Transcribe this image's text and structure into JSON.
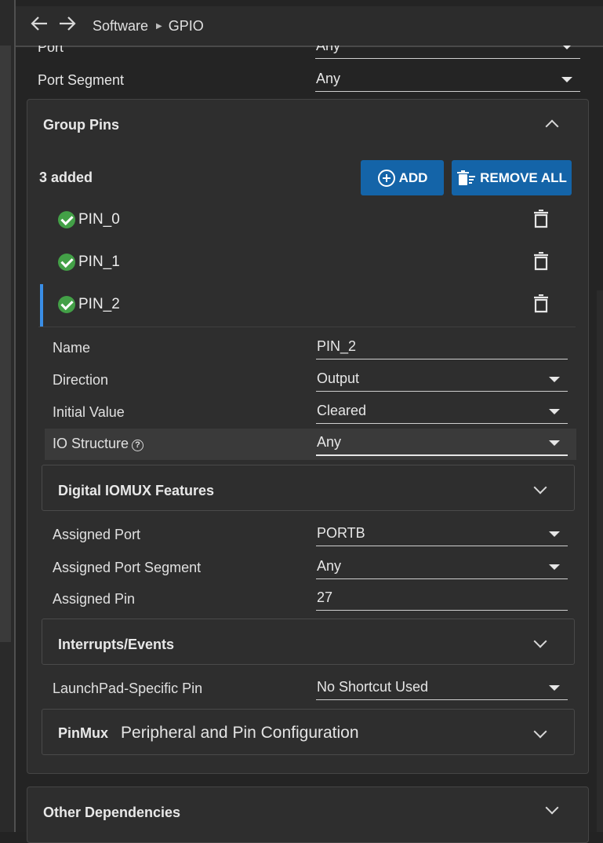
{
  "nav": {
    "back_icon": "arrow-left-icon",
    "forward_icon": "arrow-right-icon",
    "breadcrumb": [
      "Software",
      "GPIO"
    ]
  },
  "top_fields": [
    {
      "label": "Port",
      "value": "Any"
    },
    {
      "label": "Port Segment",
      "value": "Any"
    }
  ],
  "group_pins": {
    "title": "Group Pins",
    "added_count": "3 added",
    "add_label": "ADD",
    "remove_all_label": "REMOVE ALL",
    "pins": [
      {
        "name": "PIN_0",
        "status": "valid"
      },
      {
        "name": "PIN_1",
        "status": "valid"
      },
      {
        "name": "PIN_2",
        "status": "valid",
        "selected": true
      }
    ]
  },
  "pin_config": {
    "name_label": "Name",
    "name_value": "PIN_2",
    "direction_label": "Direction",
    "direction_value": "Output",
    "initial_value_label": "Initial Value",
    "initial_value_value": "Cleared",
    "io_structure_label": "IO Structure",
    "io_structure_value": "Any",
    "digital_iomux_title": "Digital IOMUX Features",
    "assigned_port_label": "Assigned Port",
    "assigned_port_value": "PORTB",
    "assigned_port_segment_label": "Assigned Port Segment",
    "assigned_port_segment_value": "Any",
    "assigned_pin_label": "Assigned Pin",
    "assigned_pin_value": "27",
    "interrupts_title": "Interrupts/Events",
    "launchpad_label": "LaunchPad-Specific Pin",
    "launchpad_value": "No Shortcut Used",
    "pinmux_title": "PinMux",
    "pinmux_desc": "Peripheral and Pin Configuration"
  },
  "other_dependencies": {
    "title": "Other Dependencies"
  },
  "colors": {
    "background": "#242424",
    "panel": "#2e2e2e",
    "button": "#1464a8",
    "check": "#43a047",
    "selection_bar": "#3a8ee6"
  }
}
